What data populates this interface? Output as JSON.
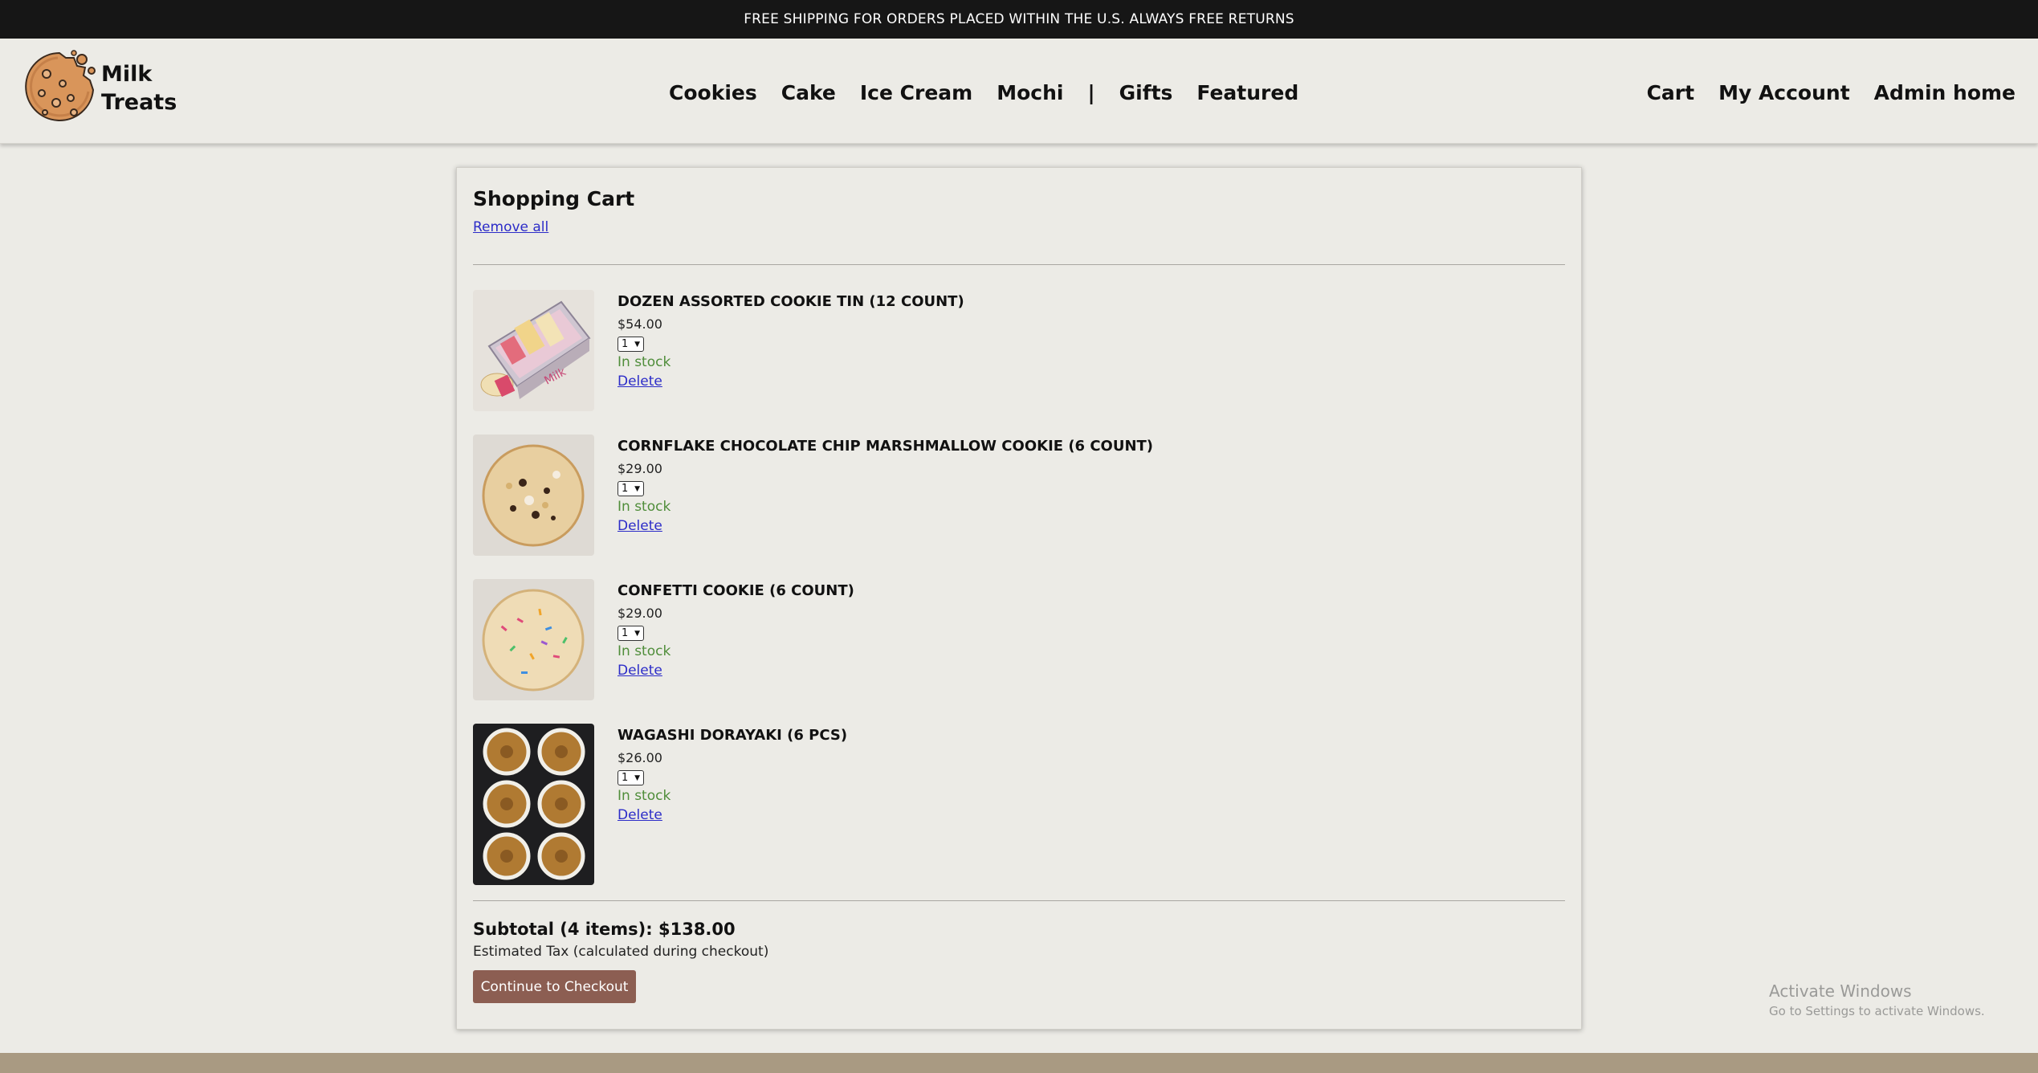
{
  "announcement": "FREE SHIPPING FOR ORDERS PLACED WITHIN THE U.S. ALWAYS FREE RETURNS",
  "brand": {
    "line1": "Milk",
    "line2": "Treats",
    "icon": "cookie-icon"
  },
  "nav": {
    "items": [
      "Cookies",
      "Cake",
      "Ice Cream",
      "Mochi"
    ],
    "separator": "|",
    "items2": [
      "Gifts",
      "Featured"
    ]
  },
  "account_nav": {
    "cart": "Cart",
    "account": "My Account",
    "admin": "Admin home"
  },
  "cart": {
    "title": "Shopping Cart",
    "remove_all": "Remove all",
    "items": [
      {
        "name": "DOZEN ASSORTED COOKIE TIN (12 COUNT)",
        "price": "$54.00",
        "qty": "1",
        "stock": "In stock",
        "delete": "Delete",
        "image": "cookie-tin-image"
      },
      {
        "name": "CORNFLAKE CHOCOLATE CHIP MARSHMALLOW COOKIE (6 COUNT)",
        "price": "$29.00",
        "qty": "1",
        "stock": "In stock",
        "delete": "Delete",
        "image": "cornflake-cookie-image"
      },
      {
        "name": "CONFETTI COOKIE (6 COUNT)",
        "price": "$29.00",
        "qty": "1",
        "stock": "In stock",
        "delete": "Delete",
        "image": "confetti-cookie-image"
      },
      {
        "name": "WAGASHI DORAYAKI (6 PCS)",
        "price": "$26.00",
        "qty": "1",
        "stock": "In stock",
        "delete": "Delete",
        "image": "dorayaki-image"
      }
    ],
    "subtotal": "Subtotal (4 items): $138.00",
    "tax_note": "Estimated Tax (calculated during checkout)",
    "checkout_label": "Continue to Checkout"
  },
  "watermark": {
    "title": "Activate Windows",
    "subtitle": "Go to Settings to activate Windows."
  },
  "colors": {
    "accent": "#8c5e52",
    "link": "#2c2cc8",
    "in_stock": "#4f8d3a",
    "topbar": "#161616",
    "footer": "#a99a82"
  }
}
